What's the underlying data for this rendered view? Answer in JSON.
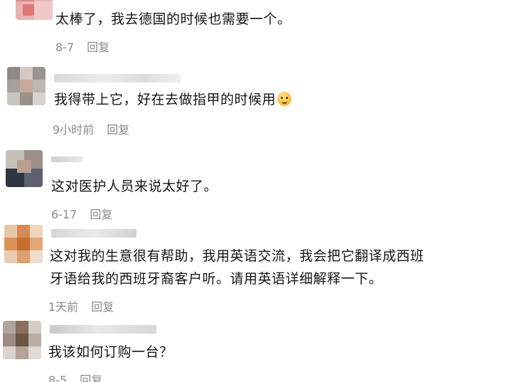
{
  "comments": [
    {
      "text": "太棒了，我去德国的时候也需要一个。",
      "date": "8-7",
      "reply_label": "回复"
    },
    {
      "text": "我得带上它，好在去做指甲的时候用",
      "emoji_icon": "smiling-face-icon",
      "date": "9小时前",
      "reply_label": "回复"
    },
    {
      "text": "这对医护人员来说太好了。",
      "date": "6-17",
      "reply_label": "回复"
    },
    {
      "text_line1": "这对我的生意很有帮助，我用英语交流，我会把它翻译成西班",
      "text_line2": "牙语给我的西班牙裔客户听。请用英语详细解释一下。",
      "date": "1天前",
      "reply_label": "回复"
    },
    {
      "text": "我该如何订购一台？",
      "date": "8-5",
      "reply_label": "回复"
    }
  ]
}
